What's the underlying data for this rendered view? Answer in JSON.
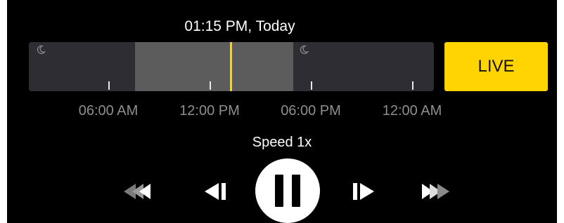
{
  "header": {
    "timestamp": "01:15 PM, Today"
  },
  "timeline": {
    "tick_labels": [
      "06:00 AM",
      "12:00 PM",
      "06:00 PM",
      "12:00 AM"
    ],
    "night_icon": "moon-icon",
    "cursor_color": "#ffd400",
    "day_color": "#5c5c5c",
    "night_color": "#2e2d33"
  },
  "live_button": {
    "label": "LIVE",
    "color": "#ffd400"
  },
  "playback": {
    "speed_label": "Speed 1x",
    "icons": [
      "rewind-icon",
      "step-back-icon",
      "pause-icon",
      "step-forward-icon",
      "fast-forward-icon"
    ]
  }
}
